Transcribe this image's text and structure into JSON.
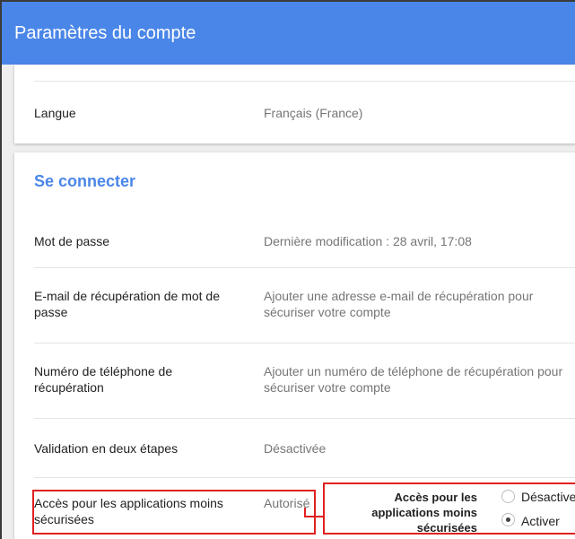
{
  "header": {
    "title": "Paramètres du compte"
  },
  "language": {
    "label": "Langue",
    "value": "Français (France)"
  },
  "signin": {
    "title": "Se connecter",
    "rows": [
      {
        "label": "Mot de passe",
        "value": "Dernière modification : 28 avril, 17:08"
      },
      {
        "label": "E-mail de récupération de mot de passe",
        "value": "Ajouter une adresse e-mail de récupération pour sécuriser votre compte"
      },
      {
        "label": "Numéro de téléphone de récupération",
        "value": "Ajouter un numéro de téléphone de récupération pour sécuriser votre compte"
      },
      {
        "label": "Validation en deux étapes",
        "value": "Désactivée"
      },
      {
        "label": "Accès pour les applications moins sécurisées",
        "value": "Autorisé"
      }
    ]
  },
  "popup": {
    "title": "Accès pour les applications moins sécurisées",
    "options": [
      {
        "label": "Désactiver",
        "checked": false
      },
      {
        "label": "Activer",
        "checked": true
      }
    ]
  },
  "colors": {
    "accent": "#4a86e8",
    "highlight": "#e02020"
  }
}
